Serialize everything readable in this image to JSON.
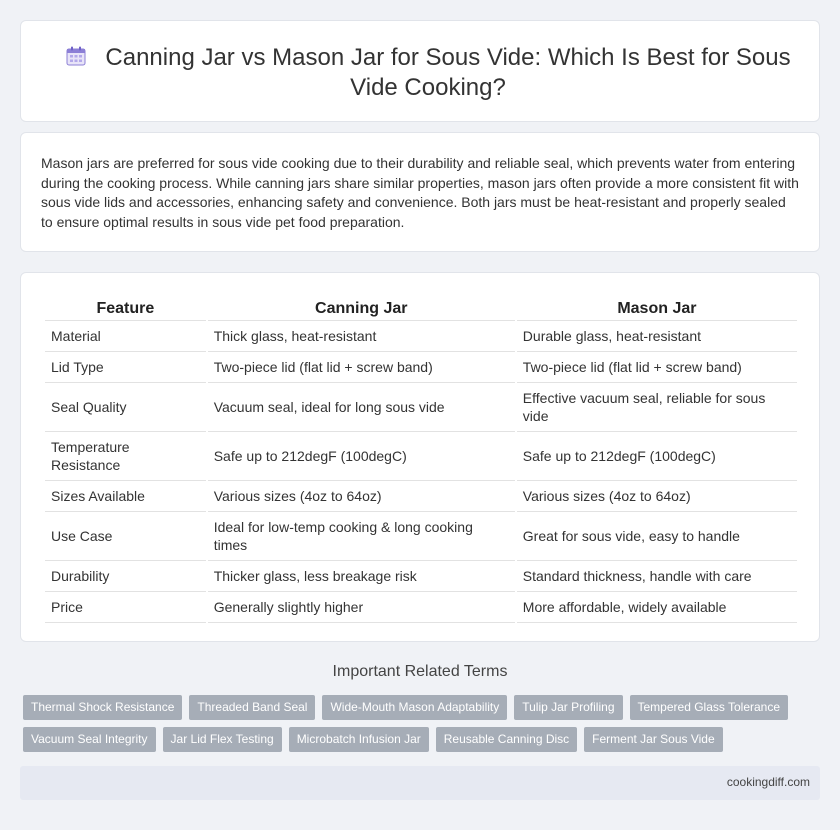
{
  "header": {
    "title": "Canning Jar vs Mason Jar for Sous Vide: Which Is Best for Sous Vide Cooking?",
    "icon": "calendar-icon"
  },
  "intro": {
    "text": "Mason jars are preferred for sous vide cooking due to their durability and reliable seal, which prevents water from entering during the cooking process. While canning jars share similar properties, mason jars often provide a more consistent fit with sous vide lids and accessories, enhancing safety and convenience. Both jars must be heat-resistant and properly sealed to ensure optimal results in sous vide pet food preparation."
  },
  "table": {
    "headers": [
      "Feature",
      "Canning Jar",
      "Mason Jar"
    ],
    "rows": [
      [
        "Material",
        "Thick glass, heat-resistant",
        "Durable glass, heat-resistant"
      ],
      [
        "Lid Type",
        "Two-piece lid (flat lid + screw band)",
        "Two-piece lid (flat lid + screw band)"
      ],
      [
        "Seal Quality",
        "Vacuum seal, ideal for long sous vide",
        "Effective vacuum seal, reliable for sous vide"
      ],
      [
        "Temperature Resistance",
        "Safe up to 212degF (100degC)",
        "Safe up to 212degF (100degC)"
      ],
      [
        "Sizes Available",
        "Various sizes (4oz to 64oz)",
        "Various sizes (4oz to 64oz)"
      ],
      [
        "Use Case",
        "Ideal for low-temp cooking & long cooking times",
        "Great for sous vide, easy to handle"
      ],
      [
        "Durability",
        "Thicker glass, less breakage risk",
        "Standard thickness, handle with care"
      ],
      [
        "Price",
        "Generally slightly higher",
        "More affordable, widely available"
      ]
    ]
  },
  "related": {
    "title": "Important Related Terms",
    "tags_row1": [
      "Thermal Shock Resistance",
      "Threaded Band Seal",
      "Wide-Mouth Mason Adaptability",
      "Tulip Jar Profiling",
      "Tempered Glass Tolerance"
    ],
    "tags_row2": [
      "Vacuum Seal Integrity",
      "Jar Lid Flex Testing",
      "Microbatch Infusion Jar",
      "Reusable Canning Disc",
      "Ferment Jar Sous Vide"
    ]
  },
  "footer": {
    "site": "cookingdiff.com"
  },
  "colors": {
    "page_bg": "#f0f2f6",
    "tag_bg": "#a6adb7",
    "footer_bg": "#e6e9f2"
  }
}
